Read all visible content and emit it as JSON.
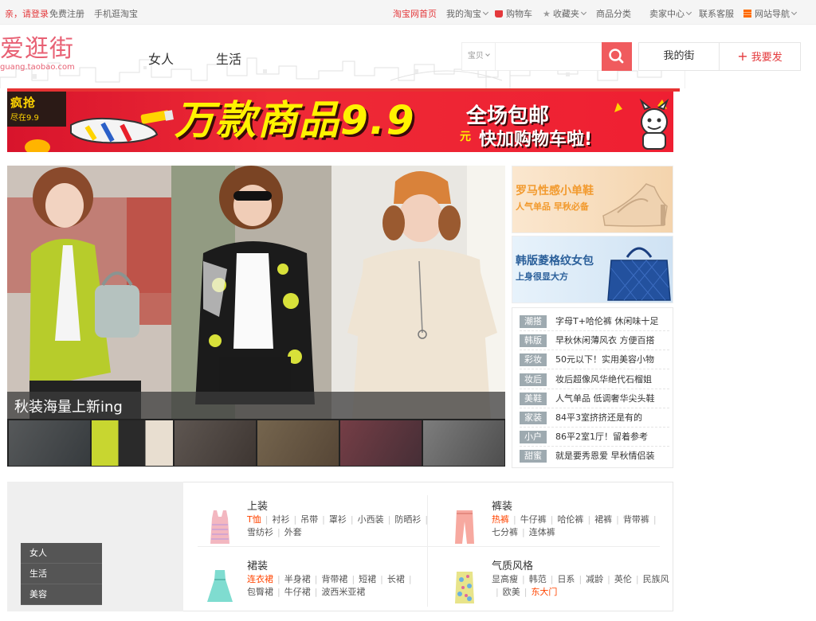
{
  "topbar": {
    "login_prompt": "亲，请登录",
    "register": "免费注册",
    "mobile": "手机逛淘宝",
    "taobao_home": "淘宝网首页",
    "my_taobao": "我的淘宝",
    "cart": "购物车",
    "favorites": "收藏夹",
    "categories": "商品分类",
    "seller_center": "卖家中心",
    "contact": "联系客服",
    "site_nav": "网站导航"
  },
  "header": {
    "logo_text": "爱逛街",
    "logo_url": "guang.taobao.com",
    "nav": [
      "女人",
      "生活"
    ],
    "search_category": "宝贝",
    "search_value": "",
    "my_street": "我的街",
    "post": "我要发"
  },
  "banner": {
    "badge_title": "疯抢",
    "badge_sub": "尽在9.9",
    "headline": "万款商品9.9",
    "currency": "元",
    "free_shipping": "全场包邮",
    "call_to_action": "快加购物车啦!"
  },
  "slideshow": {
    "caption": "秋装海量上新ing",
    "thumb_count": 6,
    "active_thumb": 1
  },
  "promos": [
    {
      "title": "罗马性感小单鞋",
      "subtitle": "人气单品 早秋必备",
      "accent": "#f29a2e"
    },
    {
      "title": "韩版菱格纹女包",
      "subtitle": "上身很显大方",
      "accent": "#2a6aa8"
    }
  ],
  "tag_list": [
    {
      "label": "潮搭",
      "text": "字母T+哈伦裤 休闲味十足"
    },
    {
      "label": "韩版",
      "text": "早秋休闲薄风衣 方便百搭"
    },
    {
      "label": "彩妆",
      "text": "50元以下！实用美容小物"
    },
    {
      "label": "妆后",
      "text": "妆后超像风华绝代石榴姐"
    },
    {
      "label": "美鞋",
      "text": "人气单品 低调奢华尖头鞋"
    },
    {
      "label": "家装",
      "text": "84平3室挤挤还是有的"
    },
    {
      "label": "小户",
      "text": "86平2室1厅！留着参考"
    },
    {
      "label": "甜蜜",
      "text": "就是要秀恩爱 早秋情侣装"
    }
  ],
  "category_nav": [
    "女人",
    "生活",
    "美容"
  ],
  "category_blocks": [
    {
      "title": "上装",
      "links": [
        {
          "t": "T恤",
          "hot": true
        },
        {
          "t": "衬衫"
        },
        {
          "t": "吊带"
        },
        {
          "t": "罩衫"
        },
        {
          "t": "小西装"
        },
        {
          "t": "防晒衫"
        },
        {
          "t": "雪纺衫"
        },
        {
          "t": "外套"
        }
      ]
    },
    {
      "title": "裤装",
      "links": [
        {
          "t": "热裤",
          "hot": true
        },
        {
          "t": "牛仔裤"
        },
        {
          "t": "哈伦裤"
        },
        {
          "t": "裙裤"
        },
        {
          "t": "背带裤"
        },
        {
          "t": "七分裤"
        },
        {
          "t": "连体裤"
        }
      ]
    },
    {
      "title": "裙装",
      "links": [
        {
          "t": "连衣裙",
          "hot": true
        },
        {
          "t": "半身裙"
        },
        {
          "t": "背带裙"
        },
        {
          "t": "短裙"
        },
        {
          "t": "长裙"
        },
        {
          "t": "包臀裙"
        },
        {
          "t": "牛仔裙"
        },
        {
          "t": "波西米亚裙"
        }
      ]
    },
    {
      "title": "气质风格",
      "links": [
        {
          "t": "显高瘦"
        },
        {
          "t": "韩范"
        },
        {
          "t": "日系"
        },
        {
          "t": "减龄"
        },
        {
          "t": "英伦"
        },
        {
          "t": "民族风"
        },
        {
          "t": "欧美"
        },
        {
          "t": "东大门",
          "hot": true
        }
      ]
    }
  ]
}
